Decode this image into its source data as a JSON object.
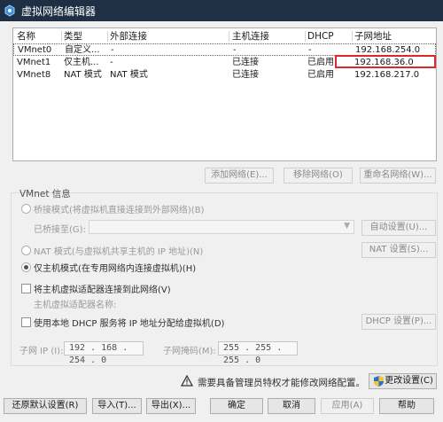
{
  "window": {
    "title": "虚拟网络编辑器"
  },
  "table": {
    "headers": [
      "名称",
      "类型",
      "外部连接",
      "主机连接",
      "DHCP",
      "子网地址"
    ],
    "rows": [
      [
        "VMnet0",
        "自定义...",
        "-",
        "-",
        "-",
        "192.168.254.0"
      ],
      [
        "VMnet1",
        "仅主机...",
        "-",
        "已连接",
        "已启用",
        "192.168.36.0"
      ],
      [
        "VMnet8",
        "NAT 模式",
        "NAT 模式",
        "已连接",
        "已启用",
        "192.168.217.0"
      ]
    ]
  },
  "buttons": {
    "add_network": "添加网络(E)...",
    "remove_network": "移除网络(O)",
    "rename_network": "重命名网络(W)...",
    "auto_settings": "自动设置(U)...",
    "nat_settings": "NAT 设置(S)...",
    "dhcp_settings": "DHCP 设置(P)...",
    "change_settings": "更改设置(C)",
    "restore_defaults": "还原默认设置(R)",
    "import": "导入(T)...",
    "export": "导出(X)...",
    "ok": "确定",
    "cancel": "取消",
    "apply": "应用(A)",
    "help": "帮助"
  },
  "vmnet_info": {
    "label": "VMnet 信息",
    "bridged": "桥接模式(将虚拟机直接连接到外部网络)(B)",
    "bridged_to_label": "已桥接至(G):",
    "nat": "NAT 模式(与虚拟机共享主机的 IP 地址)(N)",
    "host_only": "仅主机模式(在专用网络内连接虚拟机)(H)",
    "connect_adapter": "将主机虚拟适配器连接到此网络(V)",
    "adapter_name": "主机虚拟适配器名称:",
    "use_dhcp": "使用本地 DHCP 服务将 IP 地址分配给虚拟机(D)",
    "subnet_ip_label": "子网 IP (I):",
    "subnet_ip_value": "192 . 168 . 254 . 0",
    "subnet_mask_label": "子网掩码(M):",
    "subnet_mask_value": "255 . 255 . 255 . 0",
    "selected_mode": "bridged"
  },
  "admin_notice": "需要具备管理员特权才能修改网络配置。",
  "colors": {
    "titlebar": "#1f2f44",
    "highlight_border": "#e0262c"
  }
}
